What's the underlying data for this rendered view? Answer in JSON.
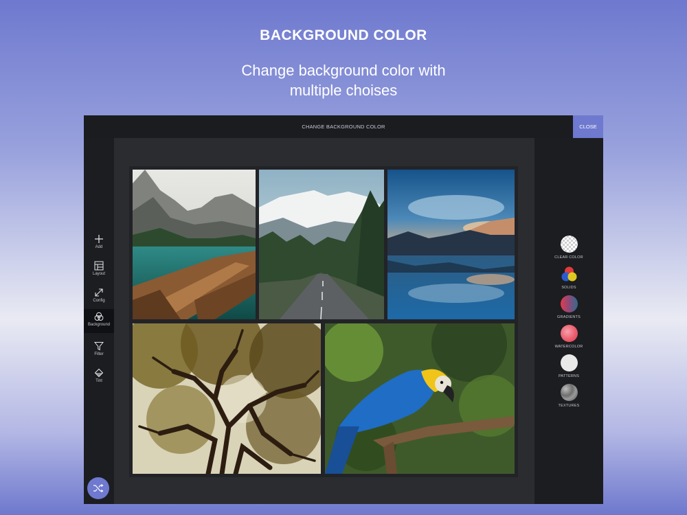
{
  "promo": {
    "headline": "BACKGROUND COLOR",
    "subtitle_line1": "Change background color with",
    "subtitle_line2": "multiple choises"
  },
  "app": {
    "title": "CHANGE BACKGROUND COLOR",
    "close_label": "CLOSE",
    "accent_color": "#6e79cf",
    "sidebar": [
      {
        "label": "Add",
        "icon": "plus-icon"
      },
      {
        "label": "Layout",
        "icon": "layout-icon"
      },
      {
        "label": "Config",
        "icon": "resize-icon"
      },
      {
        "label": "Background",
        "icon": "background-icon",
        "active": true
      },
      {
        "label": "Filter",
        "icon": "filter-icon"
      },
      {
        "label": "Tint",
        "icon": "tint-icon"
      }
    ],
    "background_options": [
      {
        "label": "CLEAR COLOR",
        "icon": "transparent-swatch"
      },
      {
        "label": "SOLIDS",
        "icon": "solids-swatch"
      },
      {
        "label": "GRADIENTS",
        "icon": "gradient-swatch"
      },
      {
        "label": "WATERCOLOR",
        "icon": "watercolor-swatch"
      },
      {
        "label": "PATTERNS",
        "icon": "pattern-swatch"
      },
      {
        "label": "TEXTURES",
        "icon": "texture-swatch"
      }
    ],
    "collage_photos": [
      {
        "subject": "mountain-lake-boat-photo"
      },
      {
        "subject": "mountain-road-photo"
      },
      {
        "subject": "mountain-lake-reflection-photo"
      },
      {
        "subject": "tree-canopy-photo"
      },
      {
        "subject": "blue-parrot-photo"
      }
    ],
    "fab_icon": "shuffle-icon"
  }
}
